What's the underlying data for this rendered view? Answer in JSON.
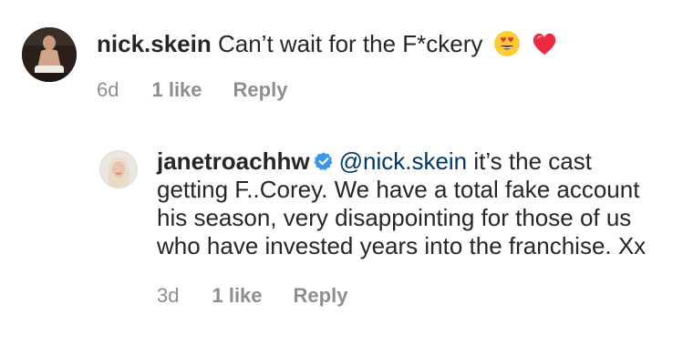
{
  "comments": [
    {
      "username": "nick.skein",
      "text": "Can’t wait for the F*ckery",
      "emojis": [
        "smiling-face-with-heart-eyes-emoji",
        "red-heart-emoji"
      ],
      "time": "6d",
      "likes": "1 like",
      "reply_label": "Reply"
    },
    {
      "username": "janetroachhw",
      "verified": true,
      "mention": "@nick.skein",
      "text": " it’s the cast getting F..Corey. We have a total fake account his season, very disappointing for those of us who have invested years into the franchise. Xx",
      "time": "3d",
      "likes": "1 like",
      "reply_label": "Reply"
    }
  ],
  "colors": {
    "text": "#262626",
    "meta": "#8e8e8e",
    "mention": "#00376b",
    "verified": "#3897f0",
    "heart": "#ed2a3f"
  }
}
